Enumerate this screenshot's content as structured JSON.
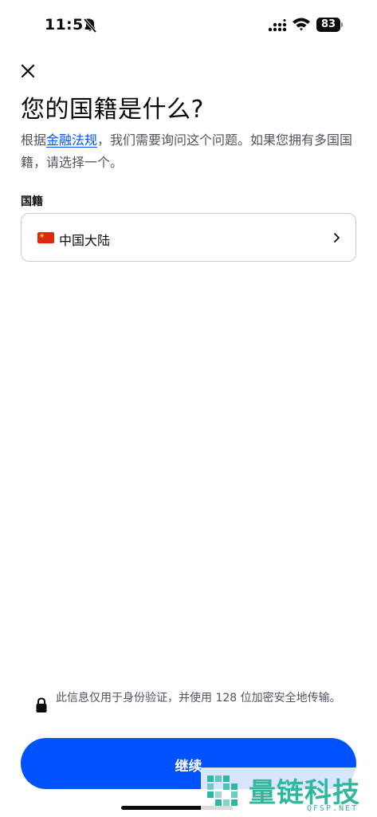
{
  "status_bar": {
    "time": "11:51",
    "battery": "83"
  },
  "header": {
    "title": "您的国籍是什么?"
  },
  "description": {
    "prefix": "根据",
    "link": "金融法规",
    "suffix": "，我们需要询问这个问题。如果您拥有多国国籍，请选择一个。"
  },
  "nationality_field": {
    "label": "国籍",
    "value": "中国大陆",
    "flag_icon": "china-flag-icon"
  },
  "footer": {
    "secure_note": "此信息仅用于身份验证，并使用 128 位加密安全地传输。",
    "continue_label": "继续"
  },
  "watermark": {
    "text": "量链科技",
    "sub": "QFSP.NET"
  },
  "colors": {
    "accent": "#0052ff",
    "text": "#0a0b0d",
    "muted": "#4f545e",
    "border": "#c8ccd3",
    "watermark": "#2fb89d"
  }
}
